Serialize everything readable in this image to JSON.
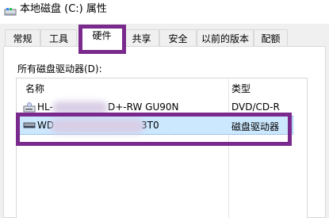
{
  "window": {
    "title": "本地磁盘 (C:) 属性"
  },
  "tabs": [
    {
      "label": "常规"
    },
    {
      "label": "工具"
    },
    {
      "label": "硬件"
    },
    {
      "label": "共享"
    },
    {
      "label": "安全"
    },
    {
      "label": "以前的版本"
    },
    {
      "label": "配额"
    }
  ],
  "active_tab": "硬件",
  "hardware": {
    "section_label": "所有磁盘驱动器(D):",
    "columns": {
      "name": "名称",
      "type": "类型"
    },
    "devices": [
      {
        "name_start": "HL-",
        "name_end": "D+-RW GU90N",
        "type": "DVD/CD-R",
        "icon": "dvd-drive-icon"
      },
      {
        "name_start": "WD",
        "name_end": "3T0",
        "type": "磁盘驱动器",
        "icon": "hard-disk-icon"
      }
    ]
  },
  "colors": {
    "highlight_outline": "#7a2a8c",
    "selection": "#cce8ff"
  }
}
